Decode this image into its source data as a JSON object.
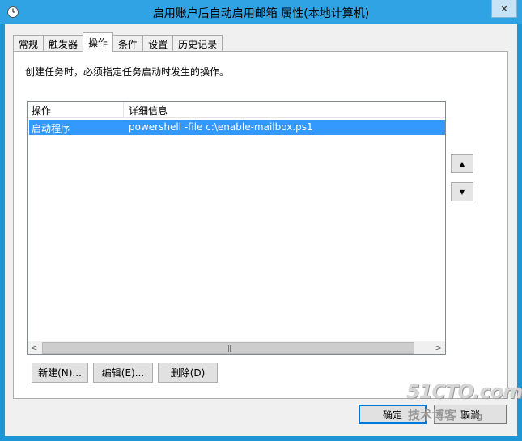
{
  "window": {
    "title": "启用账户后自动启用邮箱 属性(本地计算机)",
    "close_symbol": "✕"
  },
  "tabs": [
    {
      "label": "常规",
      "active": false
    },
    {
      "label": "触发器",
      "active": false
    },
    {
      "label": "操作",
      "active": true
    },
    {
      "label": "条件",
      "active": false
    },
    {
      "label": "设置",
      "active": false
    },
    {
      "label": "历史记录",
      "active": false
    }
  ],
  "panel": {
    "description": "创建任务时，必须指定任务启动时发生的操作。"
  },
  "actions_list": {
    "columns": [
      "操作",
      "详细信息"
    ],
    "rows": [
      {
        "action": "启动程序",
        "details": "powershell -file c:\\enable-mailbox.ps1",
        "selected": true
      }
    ],
    "scroll_left": "<",
    "scroll_right": ">",
    "scroll_grip": "|||"
  },
  "move_buttons": {
    "up": "▲",
    "down": "▼"
  },
  "buttons": {
    "new": "新建(N)...",
    "edit": "编辑(E)...",
    "delete": "删除(D)"
  },
  "dialog_buttons": {
    "ok": "确定",
    "cancel": "取消"
  },
  "watermark": {
    "site": "51CTO.com",
    "tagline": "技术博客",
    "blog": "Blog"
  },
  "colors": {
    "titlebar": "#2fa3e3",
    "selection": "#3399ff",
    "default_button_border": "#0078d7"
  }
}
